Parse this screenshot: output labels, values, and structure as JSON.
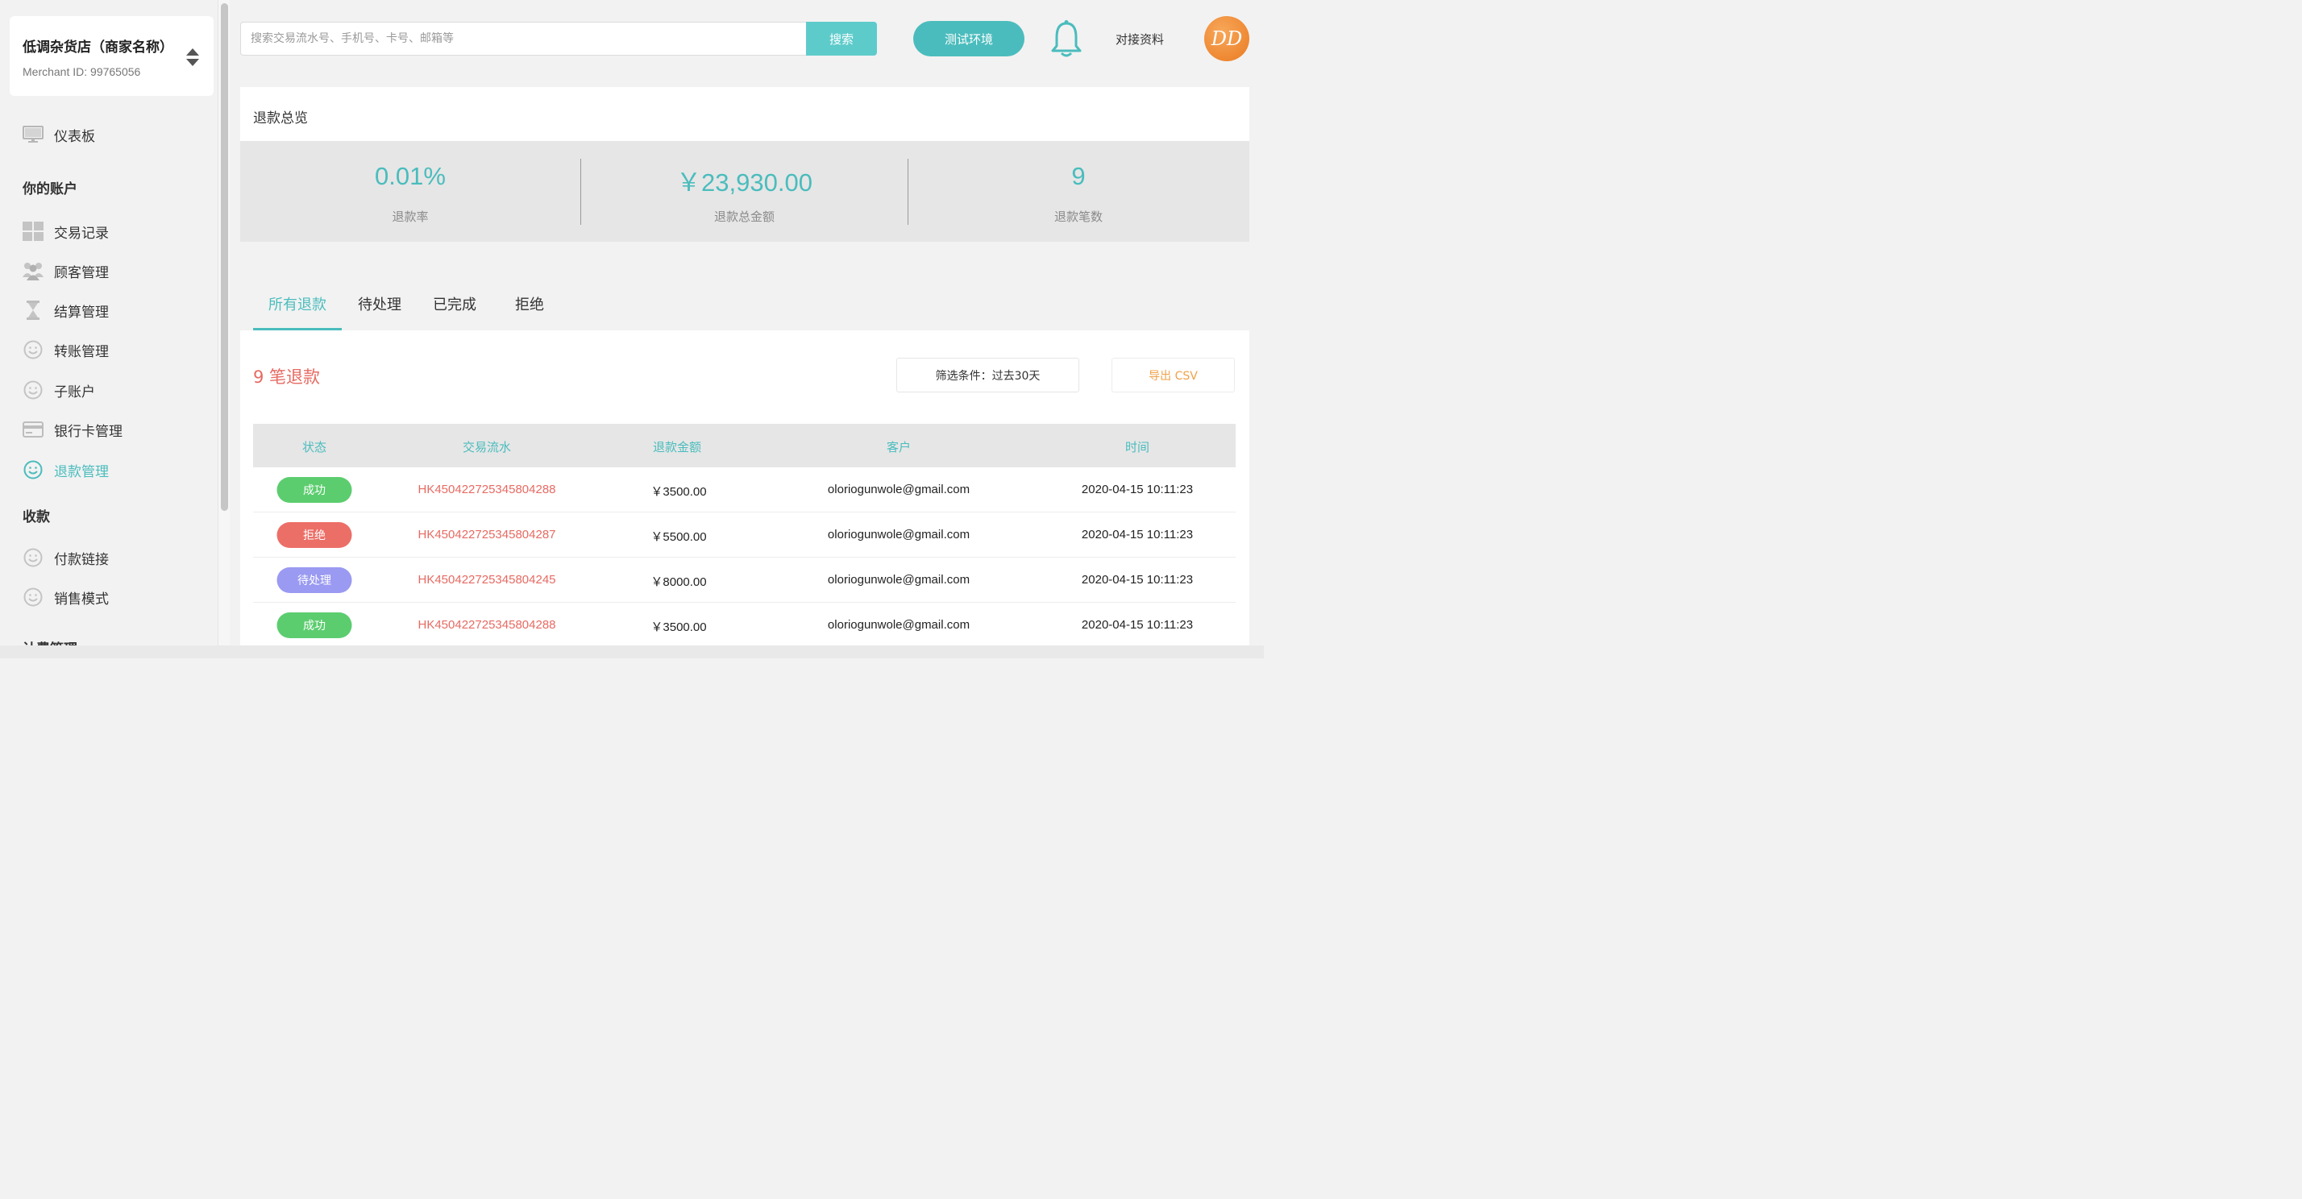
{
  "merchant": {
    "name": "低调杂货店（商家名称）",
    "id": "Merchant ID: 99765056"
  },
  "nav": {
    "dashboard": "仪表板",
    "section_account": "你的账户",
    "transactions": "交易记录",
    "customers": "顾客管理",
    "settlement": "结算管理",
    "transfers": "转账管理",
    "subaccounts": "子账户",
    "bankcards": "银行卡管理",
    "refunds": "退款管理",
    "section_collect": "收款",
    "paylinks": "付款链接",
    "salesmode": "销售模式",
    "section_plans": "计费管理"
  },
  "topbar": {
    "search_placeholder": "搜索交易流水号、手机号、卡号、邮箱等",
    "search_button": "搜索",
    "env_button": "测试环境",
    "docs_link": "对接资料",
    "avatar_text": "DD"
  },
  "overview": {
    "title": "退款总览",
    "stats": [
      {
        "value": "0.01%",
        "label": "退款率"
      },
      {
        "value": "￥23,930.00",
        "label": "退款总金额"
      },
      {
        "value": "9",
        "label": "退款笔数"
      }
    ]
  },
  "tabs": [
    "所有退款",
    "待处理",
    "已完成",
    "拒绝"
  ],
  "refunds": {
    "count_title": "9 笔退款",
    "filter_button": "筛选条件：过去30天",
    "export_button": "导出 CSV",
    "columns": [
      "状态",
      "交易流水",
      "退款金额",
      "客户",
      "时间"
    ],
    "rows": [
      {
        "status": "成功",
        "txid": "HK450422725345804288",
        "amount": "￥3500.00",
        "customer": "oloriogunwole@gmail.com",
        "time": "2020-04-15 10:11:23"
      },
      {
        "status": "拒绝",
        "txid": "HK450422725345804287",
        "amount": "￥5500.00",
        "customer": "oloriogunwole@gmail.com",
        "time": "2020-04-15 10:11:23"
      },
      {
        "status": "待处理",
        "txid": "HK450422725345804245",
        "amount": "￥8000.00",
        "customer": "oloriogunwole@gmail.com",
        "time": "2020-04-15 10:11:23"
      },
      {
        "status": "成功",
        "txid": "HK450422725345804288",
        "amount": "￥3500.00",
        "customer": "oloriogunwole@gmail.com",
        "time": "2020-04-15 10:11:23"
      }
    ]
  },
  "colors": {
    "accent": "#4bbcbd",
    "success": "#5ccd6f",
    "rejected": "#ec6f67",
    "pending": "#9a9af2",
    "txid": "#e76a62",
    "export": "#f0a24a"
  }
}
